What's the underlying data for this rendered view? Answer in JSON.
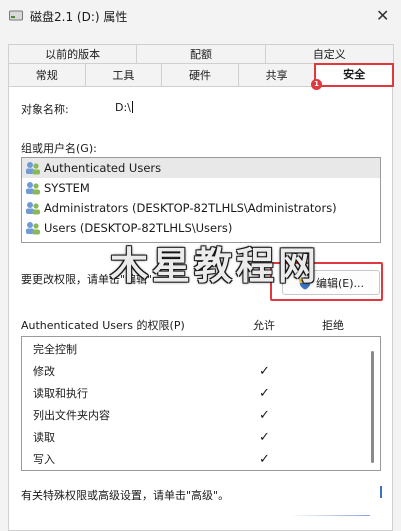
{
  "window": {
    "title": "磁盘2.1 (D:) 属性",
    "close_label": "✕"
  },
  "tabs": {
    "row1": [
      {
        "label": "以前的版本"
      },
      {
        "label": "配额"
      },
      {
        "label": "自定义"
      }
    ],
    "row2": [
      {
        "label": "常规"
      },
      {
        "label": "工具"
      },
      {
        "label": "硬件"
      },
      {
        "label": "共享"
      },
      {
        "label": "安全",
        "active": true
      }
    ],
    "annotation_badge": "1"
  },
  "security": {
    "object_name_label": "对象名称:",
    "object_name_value": "D:\\",
    "groups_label": "组或用户名(G):",
    "users": [
      {
        "name": "Authenticated Users",
        "selected": true
      },
      {
        "name": "SYSTEM"
      },
      {
        "name": "Administrators (DESKTOP-82TLHLS\\Administrators)"
      },
      {
        "name": "Users (DESKTOP-82TLHLS\\Users)"
      }
    ],
    "change_hint": "要更改权限，请单击\"编辑\"",
    "edit_button_label": "编辑(E)...",
    "permissions_for": "Authenticated Users 的权限(P)",
    "allow_label": "允许",
    "deny_label": "拒绝",
    "permissions": [
      {
        "name": "完全控制",
        "allow": ""
      },
      {
        "name": "修改",
        "allow": "✓"
      },
      {
        "name": "读取和执行",
        "allow": "✓"
      },
      {
        "name": "列出文件夹内容",
        "allow": "✓"
      },
      {
        "name": "读取",
        "allow": "✓"
      },
      {
        "name": "写入",
        "allow": "✓"
      }
    ],
    "special_hint": "有关特殊权限或高级设置，请单击\"高级\"。"
  },
  "watermark": "木星教程网",
  "colors": {
    "highlight": "#e0383d",
    "accent": "#3b72c4"
  }
}
